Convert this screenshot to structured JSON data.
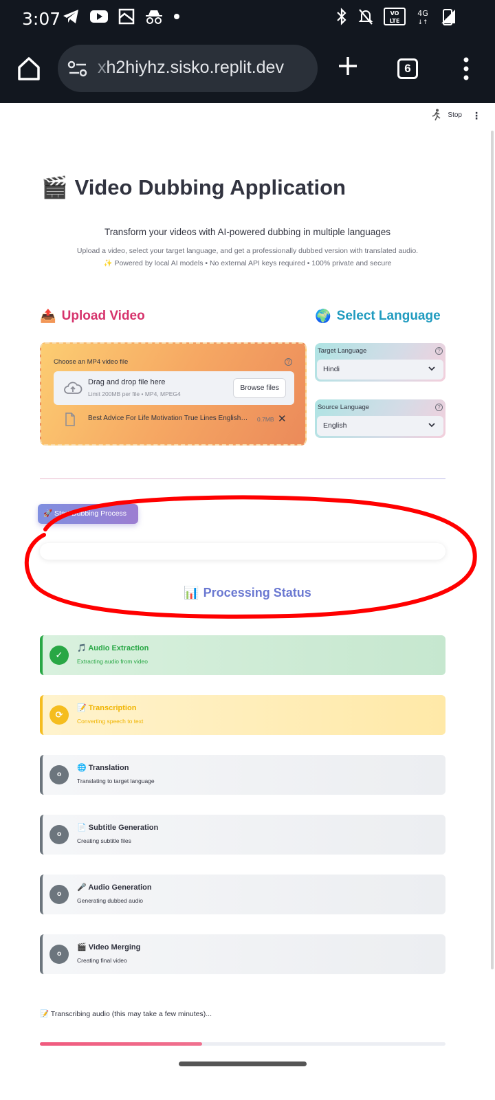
{
  "status_bar": {
    "time": "3:07"
  },
  "browser": {
    "url_prefix": "x",
    "url_main": "h2hiyhz.sisko.replit.dev",
    "tab_count": "6"
  },
  "app_header": {
    "running_label": "Stop"
  },
  "hero": {
    "title": "Video Dubbing Application",
    "title_icon": "🎬",
    "subtitle": "Transform your videos with AI-powered dubbing in multiple languages",
    "description": "Upload a video, select your target language, and get a professionally dubbed version with translated audio.",
    "features": "✨ Powered by local AI models • No external API keys required • 100% private and secure"
  },
  "upload": {
    "heading": "Upload Video",
    "heading_icon": "📤",
    "field_label": "Choose an MP4 video file",
    "drop_title": "Drag and drop file here",
    "drop_limit": "Limit 200MB per file • MP4, MPEG4",
    "browse_label": "Browse files",
    "file_name": "Best Advice For Life Motivation True Lines English…",
    "file_size": "0.7MB",
    "remove_label": "✕"
  },
  "language": {
    "heading": "Select Language",
    "heading_icon": "🌍",
    "target_label": "Target Language",
    "target_value": "Hindi",
    "source_label": "Source Language",
    "source_value": "English"
  },
  "actions": {
    "start_label": "🚀 Start Dubbing Process"
  },
  "processing": {
    "heading": "Processing Status",
    "heading_icon": "📊",
    "steps": [
      {
        "title": "🎵 Audio Extraction",
        "desc": "Extracting audio from video",
        "state": "done",
        "badge": "✓"
      },
      {
        "title": "📝 Transcription",
        "desc": "Converting speech to text",
        "state": "active",
        "badge": "⟳"
      },
      {
        "title": "🌐 Translation",
        "desc": "Translating to target language",
        "state": "pending",
        "badge": "o"
      },
      {
        "title": "📄 Subtitle Generation",
        "desc": "Creating subtitle files",
        "state": "pending",
        "badge": "o"
      },
      {
        "title": "🎤 Audio Generation",
        "desc": "Generating dubbed audio",
        "state": "pending",
        "badge": "o"
      },
      {
        "title": "🎬 Video Merging",
        "desc": "Creating final video",
        "state": "pending",
        "badge": "o"
      }
    ],
    "progress_text": "📝 Transcribing audio (this may take a few minutes)...",
    "progress_fraction": 0.4
  },
  "colors": {
    "status_bar_bg": "#12171f",
    "upload_heading": "#d6336c",
    "language_heading": "#1f9bbf",
    "processing_heading": "#6a78d1",
    "done": "#28a745",
    "active": "#f5bd1f",
    "pending": "#6c757d",
    "annotation": "#ff0000"
  }
}
